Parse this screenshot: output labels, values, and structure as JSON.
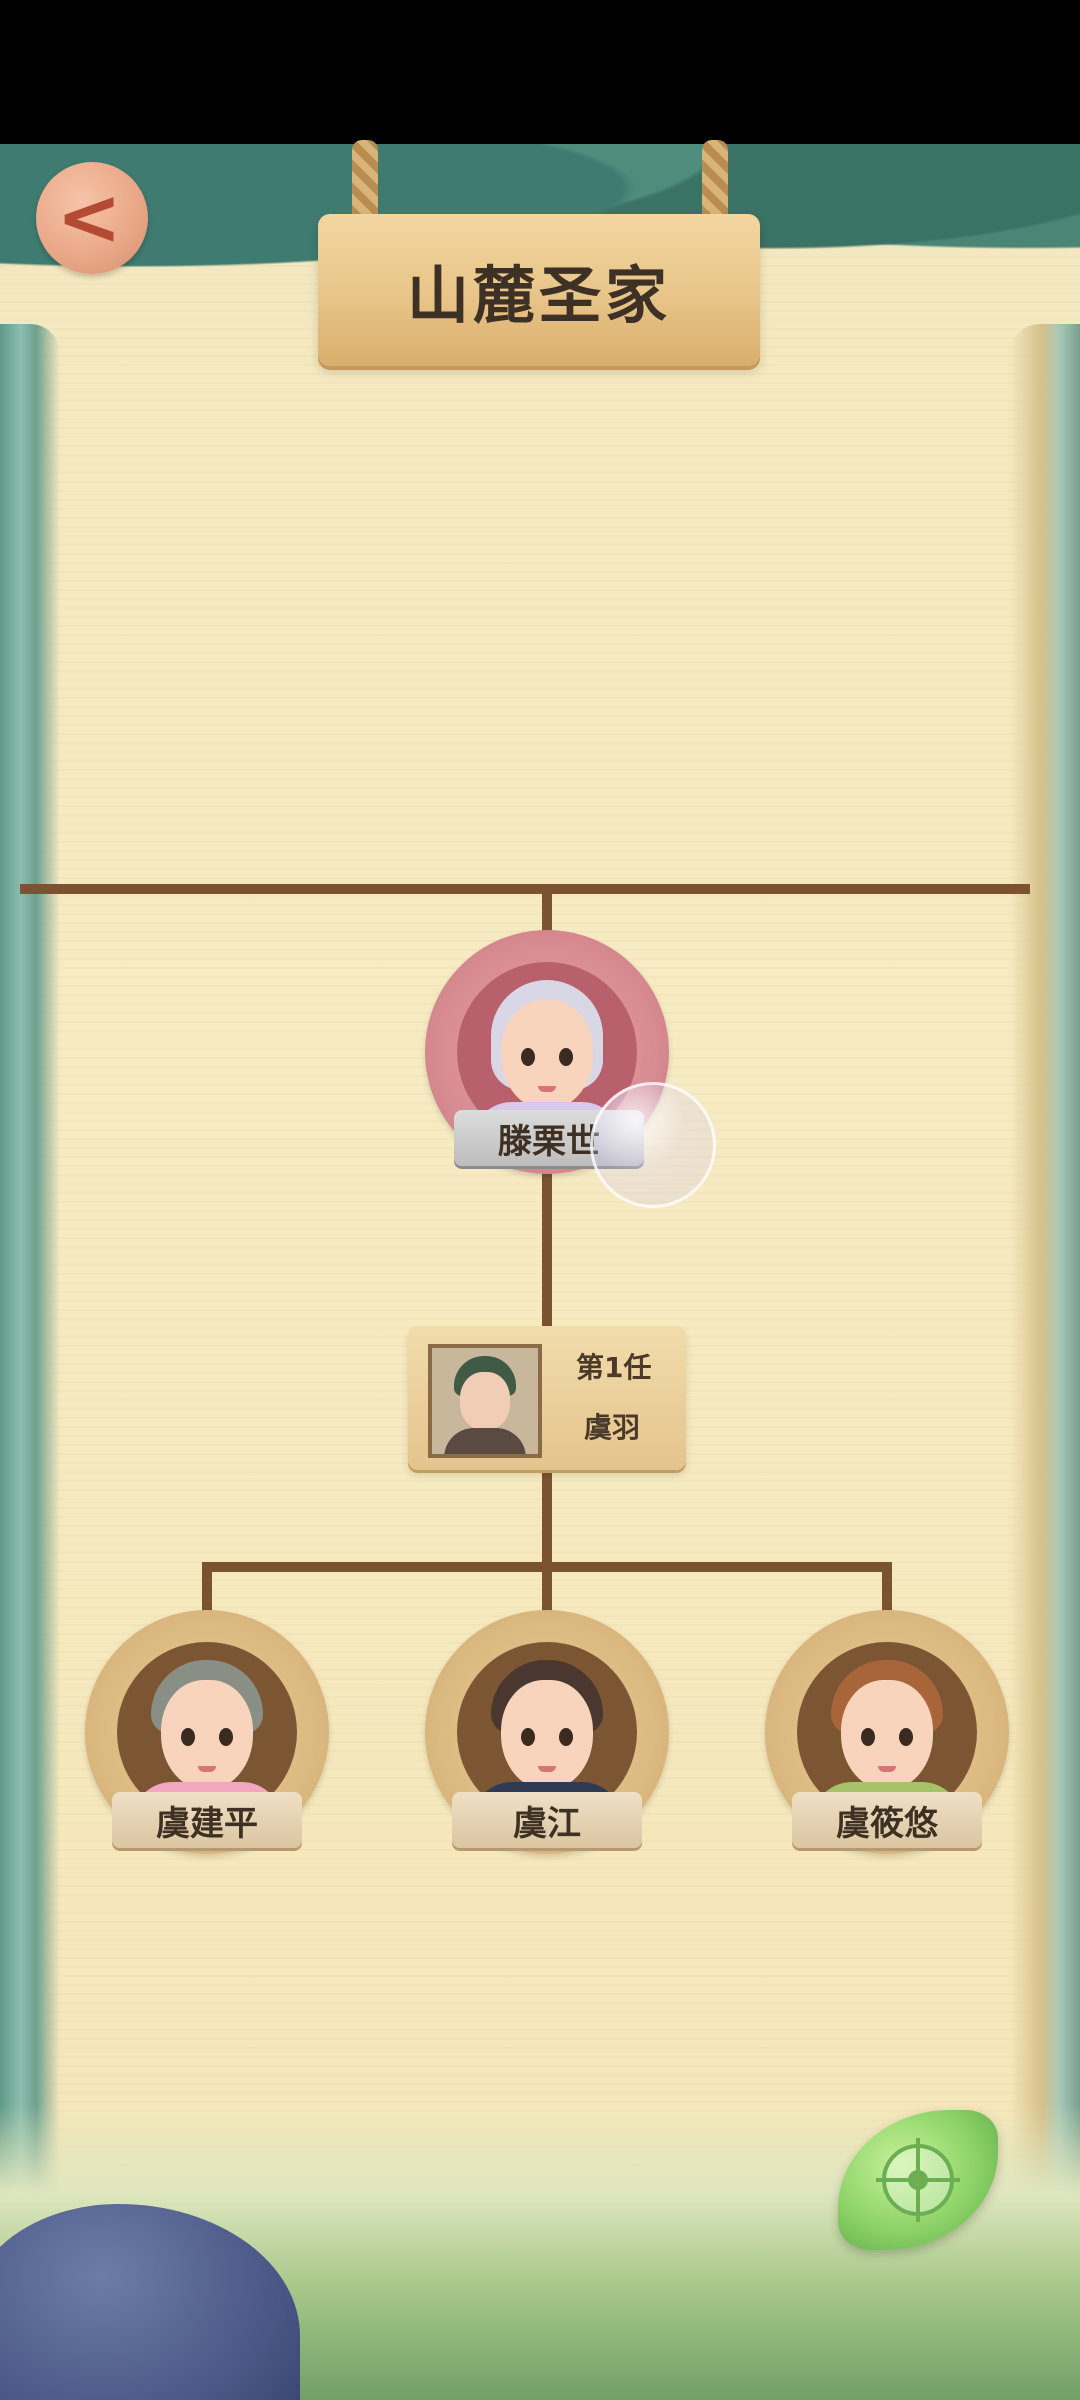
{
  "header": {
    "title": "山麓圣家",
    "back_label": "<"
  },
  "root": {
    "name": "滕栗世",
    "frame": "pink"
  },
  "spouse": {
    "order": "第1任",
    "name": "虞羽"
  },
  "children": [
    {
      "name": "虞建平",
      "hair": "#8a8f86",
      "shirt": "#f2a6c0"
    },
    {
      "name": "虞江",
      "hair": "#4a3830",
      "shirt": "#2f3a52"
    },
    {
      "name": "虞筱悠",
      "hair": "#a8653a",
      "shirt": "#a8c26a"
    }
  ],
  "colors": {
    "line": "#7b5331",
    "paper": "#f6e9c0",
    "accent": "#8cd267"
  },
  "icons": {
    "back": "chevron-left-icon",
    "locate": "target-icon"
  }
}
